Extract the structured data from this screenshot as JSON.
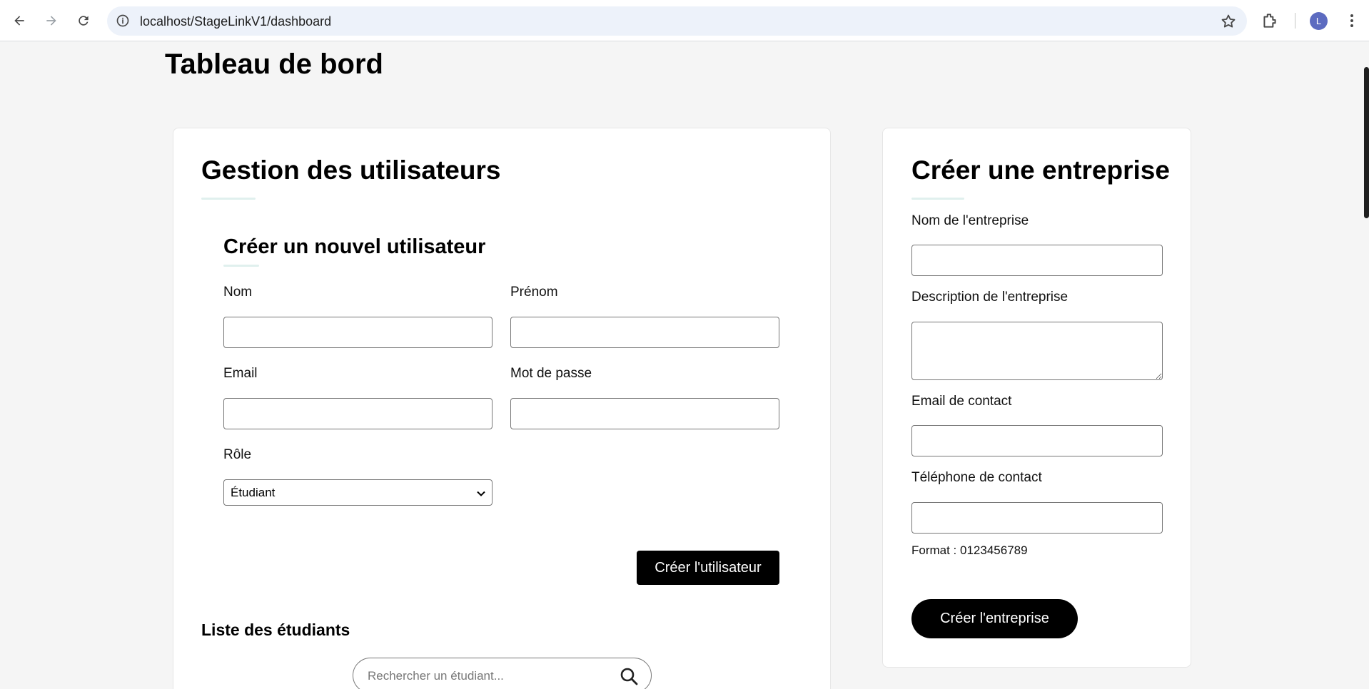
{
  "browser": {
    "url": "localhost/StageLinkV1/dashboard",
    "avatar_letter": "L",
    "accent": "#5c6bc0"
  },
  "page": {
    "title": "Tableau de bord"
  },
  "users_card": {
    "heading": "Gestion des utilisateurs",
    "create_heading": "Créer un nouvel utilisateur",
    "labels": {
      "nom": "Nom",
      "prenom": "Prénom",
      "email": "Email",
      "password": "Mot de passe",
      "role": "Rôle"
    },
    "role_selected": "Étudiant",
    "submit_label": "Créer l'utilisateur",
    "list_heading": "Liste des étudiants",
    "search_placeholder": "Rechercher un étudiant..."
  },
  "company_card": {
    "heading": "Créer une entreprise",
    "labels": {
      "name": "Nom de l'entreprise",
      "description": "Description de l'entreprise",
      "email": "Email de contact",
      "phone": "Téléphone de contact"
    },
    "phone_hint": "Format : 0123456789",
    "submit_label": "Créer l'entreprise"
  }
}
